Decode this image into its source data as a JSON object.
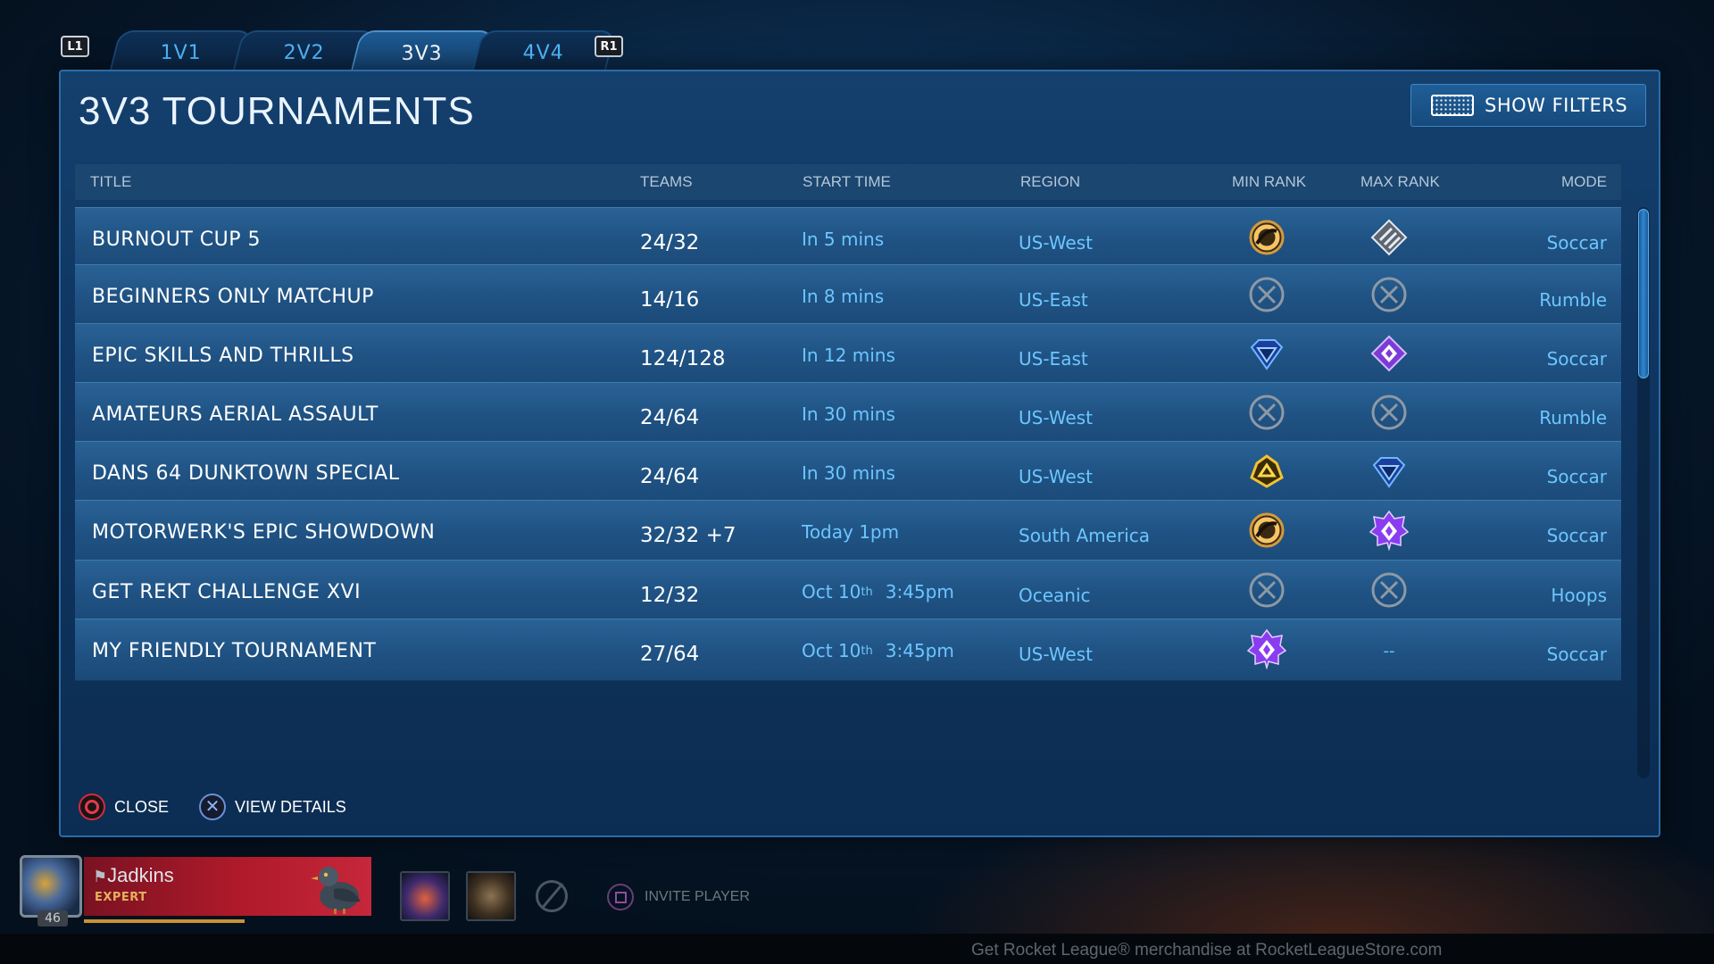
{
  "tabs": {
    "left_shoulder": "L1",
    "right_shoulder": "R1",
    "items": [
      {
        "label": "1V1",
        "active": false
      },
      {
        "label": "2V2",
        "active": false
      },
      {
        "label": "3V3",
        "active": true
      },
      {
        "label": "4V4",
        "active": false
      }
    ]
  },
  "panel": {
    "title": "3V3 TOURNAMENTS",
    "filters_label": "SHOW FILTERS"
  },
  "columns": {
    "title": "TITLE",
    "teams": "TEAMS",
    "start": "START TIME",
    "region": "REGION",
    "min_rank": "MIN RANK",
    "max_rank": "MAX RANK",
    "mode": "MODE"
  },
  "rows": [
    {
      "title": "BURNOUT CUP 5",
      "teams": "24/32",
      "start": "In 5 mins",
      "start_sup": "",
      "start_time": "",
      "region": "US-West",
      "min_rank": "platinum-ring-icon",
      "max_rank": "silver-diamond-icon",
      "mode": "Soccar"
    },
    {
      "title": "BEGINNERS ONLY MATCHUP",
      "teams": "14/16",
      "start": "In 8 mins",
      "start_sup": "",
      "start_time": "",
      "region": "US-East",
      "min_rank": "no-rank-icon",
      "max_rank": "no-rank-icon",
      "mode": "Rumble"
    },
    {
      "title": "EPIC SKILLS AND THRILLS",
      "teams": "124/128",
      "start": "In 12 mins",
      "start_sup": "",
      "start_time": "",
      "region": "US-East",
      "min_rank": "diamond-icon",
      "max_rank": "champion-icon",
      "mode": "Soccar"
    },
    {
      "title": "AMATEURS AERIAL ASSAULT",
      "teams": "24/64",
      "start": "In 30 mins",
      "start_sup": "",
      "start_time": "",
      "region": "US-West",
      "min_rank": "no-rank-icon",
      "max_rank": "no-rank-icon",
      "mode": "Rumble"
    },
    {
      "title": "DANS 64 DUNKTOWN SPECIAL",
      "teams": "24/64",
      "start": "In 30 mins",
      "start_sup": "",
      "start_time": "",
      "region": "US-West",
      "min_rank": "gold-icon",
      "max_rank": "diamond-icon",
      "mode": "Soccar"
    },
    {
      "title": "MOTORWERK'S EPIC SHOWDOWN",
      "teams": "32/32 +7",
      "start": "Today 1pm",
      "start_sup": "",
      "start_time": "",
      "region": "South America",
      "min_rank": "platinum-ring-icon",
      "max_rank": "grand-champion-icon",
      "mode": "Soccar"
    },
    {
      "title": "GET REKT CHALLENGE XVI",
      "teams": "12/32",
      "start": "Oct 10",
      "start_sup": "th",
      "start_time": "3:45pm",
      "region": "Oceanic",
      "min_rank": "no-rank-icon",
      "max_rank": "no-rank-icon",
      "mode": "Hoops"
    },
    {
      "title": "MY FRIENDLY TOURNAMENT",
      "teams": "27/64",
      "start": "Oct 10",
      "start_sup": "th",
      "start_time": "3:45pm",
      "region": "US-West",
      "min_rank": "grand-champion-icon",
      "max_rank": "--",
      "mode": "Soccar"
    }
  ],
  "footer": {
    "close_label": "CLOSE",
    "details_label": "VIEW DETAILS"
  },
  "player": {
    "name": "Jadkins",
    "title": "EXPERT",
    "level": "46"
  },
  "invite_label": "INVITE PLAYER",
  "merch_text": "Get Rocket League® merchandise at RocketLeagueStore.com",
  "colors": {
    "accent": "#6cc6ff",
    "row_bg": "#1f5283",
    "panel_bg": "#0f3560",
    "nameplate": "#b01a2a"
  }
}
